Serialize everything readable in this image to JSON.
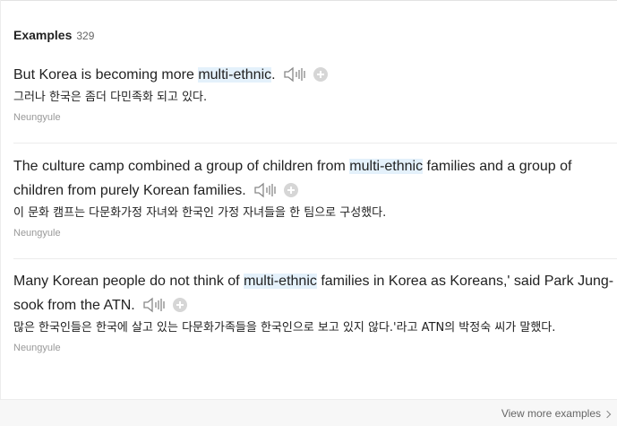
{
  "header": {
    "title": "Examples",
    "count": "329"
  },
  "examples": [
    {
      "en_before": "But Korea is becoming more ",
      "en_highlight": "multi-ethnic",
      "en_after": ".",
      "ko": "그러나 한국은 좀더 다민족화 되고 있다.",
      "source": "Neungyule"
    },
    {
      "en_before": "The culture camp combined a group of children from ",
      "en_highlight": "multi-ethnic",
      "en_after": " families and a group of children from purely Korean families.",
      "ko": "이 문화 캠프는 다문화가정 자녀와 한국인 가정 자녀들을 한 팀으로 구성했다.",
      "source": "Neungyule"
    },
    {
      "en_before": "Many Korean people do not think of ",
      "en_highlight": "multi-ethnic",
      "en_after": " families in Korea as Koreans,' said Park Jung-sook from the ATN.",
      "ko": "많은 한국인들은 한국에 살고 있는 다문화가족들을 한국인으로 보고 있지 않다.'라고 ATN의 박정숙 씨가 말했다.",
      "source": "Neungyule"
    }
  ],
  "footer": {
    "view_more_label": "View more examples"
  },
  "icons": {
    "speaker": "speaker-icon",
    "add": "plus-icon",
    "chevron": "chevron-right-icon"
  },
  "colors": {
    "highlight": "#e4f1fb",
    "muted": "#999999"
  }
}
